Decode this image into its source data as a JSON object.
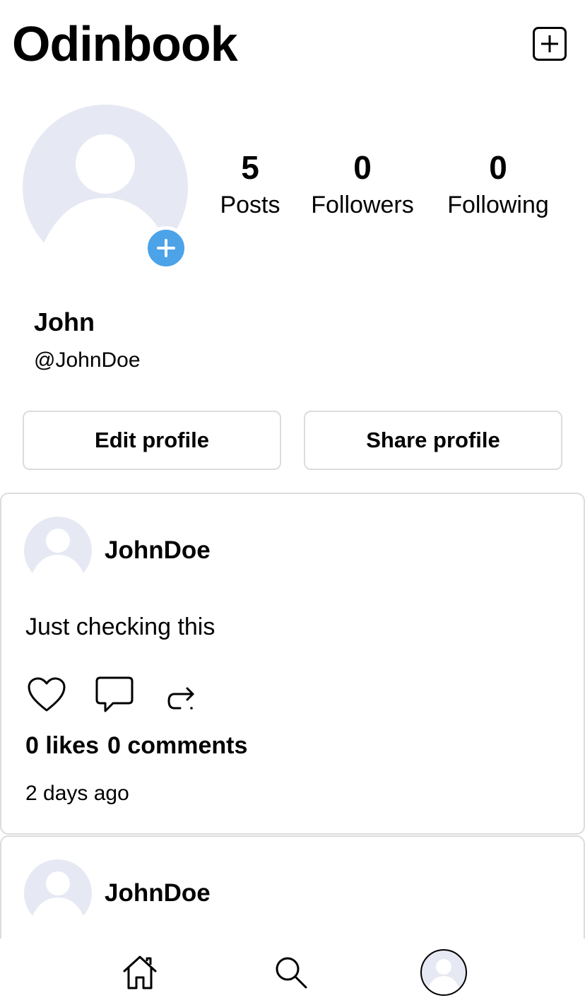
{
  "header": {
    "title": "Odinbook",
    "new_post_icon": "plus-square-icon"
  },
  "profile": {
    "avatar_icon": "default-avatar-icon",
    "add_photo_icon": "plus-circle-icon",
    "accent_color": "#4ca3e8",
    "stats": [
      {
        "value": "5",
        "label": "Posts"
      },
      {
        "value": "0",
        "label": "Followers"
      },
      {
        "value": "0",
        "label": "Following"
      }
    ],
    "display_name": "John",
    "handle": "@JohnDoe",
    "edit_label": "Edit profile",
    "share_label": "Share profile"
  },
  "posts": [
    {
      "username": "JohnDoe",
      "body": "Just checking this",
      "likes": "0 likes",
      "comments": "0 comments",
      "time": "2 days ago"
    },
    {
      "username": "JohnDoe"
    }
  ],
  "bottom_nav": {
    "items": [
      {
        "icon": "home-icon"
      },
      {
        "icon": "search-icon"
      },
      {
        "icon": "profile-avatar-icon"
      }
    ]
  }
}
